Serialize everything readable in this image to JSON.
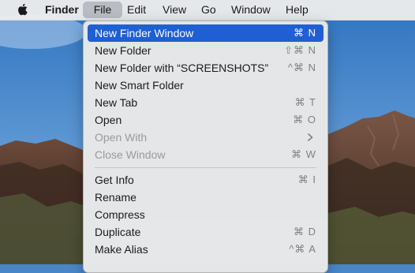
{
  "menubar": {
    "apple_icon": "apple-icon",
    "app_name": "Finder",
    "items": [
      "File",
      "Edit",
      "View",
      "Go",
      "Window",
      "Help"
    ]
  },
  "file_menu": {
    "group1": [
      {
        "label": "New Finder Window",
        "shortcut": "⌘ N",
        "state": "highlighted"
      },
      {
        "label": "New Folder",
        "shortcut": "⇧⌘ N",
        "state": "enabled"
      },
      {
        "label": "New Folder with “SCREENSHOTS”",
        "shortcut": "^⌘ N",
        "state": "enabled"
      },
      {
        "label": "New Smart Folder",
        "shortcut": "",
        "state": "enabled"
      },
      {
        "label": "New Tab",
        "shortcut": "⌘ T",
        "state": "enabled"
      },
      {
        "label": "Open",
        "shortcut": "⌘ O",
        "state": "enabled"
      },
      {
        "label": "Open With",
        "shortcut": "",
        "state": "disabled",
        "submenu_icon": "chevron-right-icon"
      },
      {
        "label": "Close Window",
        "shortcut": "⌘ W",
        "state": "disabled"
      }
    ],
    "group2": [
      {
        "label": "Get Info",
        "shortcut": "⌘  I",
        "state": "enabled"
      },
      {
        "label": "Rename",
        "shortcut": "",
        "state": "enabled"
      },
      {
        "label": "Compress",
        "shortcut": "",
        "state": "enabled"
      },
      {
        "label": "Duplicate",
        "shortcut": "⌘ D",
        "state": "enabled"
      },
      {
        "label": "Make Alias",
        "shortcut": "^⌘ A",
        "state": "enabled"
      }
    ]
  },
  "colors": {
    "highlight": "#1f5fd3",
    "menu_bg": "#e8e8e8",
    "menubar_bg": "#ececec",
    "shortcut_text": "#808080",
    "disabled_text": "#9a9a9a"
  }
}
